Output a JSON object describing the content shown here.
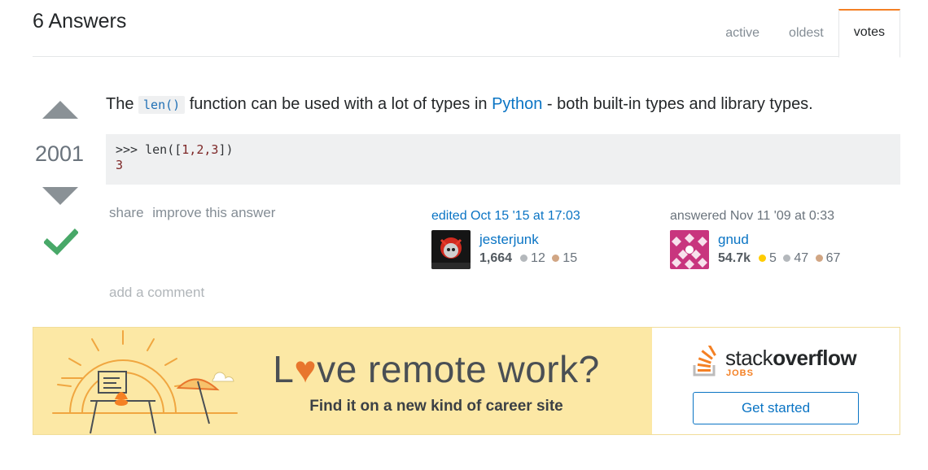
{
  "header": {
    "answers_count": "6 Answers",
    "tabs": [
      {
        "label": "active"
      },
      {
        "label": "oldest"
      },
      {
        "label": "votes",
        "selected": true
      }
    ]
  },
  "vote": {
    "score": "2001",
    "accepted": true
  },
  "answer": {
    "text_before": "The ",
    "code_inline": "len()",
    "text_middle": " function can be used with a lot of types in ",
    "link_text": "Python",
    "text_after": " - both built-in types and library types.",
    "code_block": {
      "line1_prompt": ">>> len([",
      "line1_args": "1,2,3",
      "line1_end": "])",
      "line2": "3"
    }
  },
  "post_menu": {
    "share": "share",
    "improve": "improve this answer"
  },
  "editor": {
    "action": "edited Oct 15 '15 at 17:03",
    "name": "jesterjunk",
    "reputation": "1,664",
    "silver": "12",
    "bronze": "15"
  },
  "owner": {
    "action": "answered Nov 11 '09 at 0:33",
    "name": "gnud",
    "reputation": "54.7k",
    "gold": "5",
    "silver": "47",
    "bronze": "67"
  },
  "add_comment": "add a comment",
  "ad": {
    "headline_pre": "L",
    "headline_heart": "♥",
    "headline_post": "ve remote work?",
    "subline": "Find it on a new kind of career site",
    "logo_light": "stack",
    "logo_bold": "overflow",
    "logo_jobs": "JOBS",
    "cta": "Get started",
    "colors": {
      "banner_bg": "#fce8a5",
      "accent": "#f48024",
      "link": "#0a74c4"
    }
  }
}
